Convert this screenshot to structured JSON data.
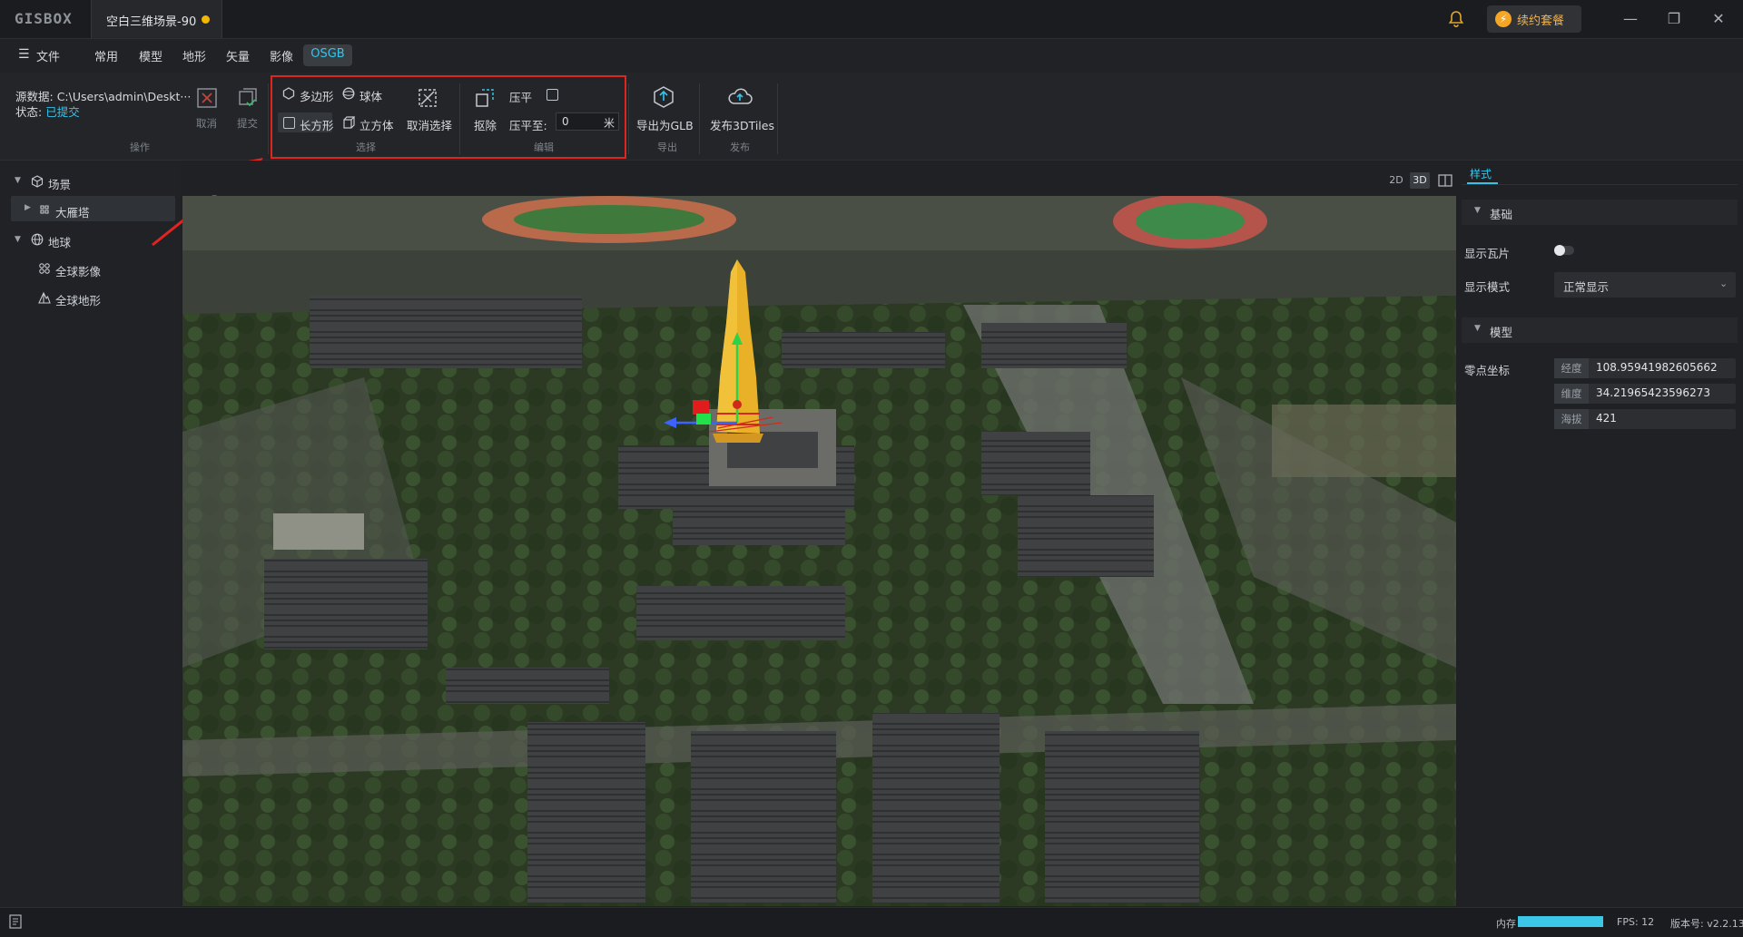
{
  "app": {
    "logo": "GISBOX",
    "doc_tab": "空白三维场景-90",
    "renew_label": "续约套餐",
    "icons": {
      "bell": "bell-icon",
      "renew": "bolt-icon",
      "minimize": "minimize-icon",
      "restore": "restore-icon",
      "close": "close-icon"
    }
  },
  "menu": {
    "file": "文件",
    "items": [
      "常用",
      "模型",
      "地形",
      "矢量",
      "影像",
      "OSGB"
    ],
    "active": "OSGB"
  },
  "ribbon": {
    "source_label": "源数据:",
    "source_value": "C:\\Users\\admin\\Deskt···",
    "status_label": "状态:",
    "status_value": "已提交",
    "cancel": "取消",
    "submit": "提交",
    "group_ops": "操作",
    "polygon": "多边形",
    "sphere": "球体",
    "rectangle": "长方形",
    "cube": "立方体",
    "deselect": "取消选择",
    "group_select": "选择",
    "erase": "抠除",
    "flatten": "压平",
    "flatten_to": "压平至:",
    "flatten_value": "0",
    "flatten_unit": "米",
    "group_edit": "编辑",
    "export_glb": "导出为GLB",
    "group_export": "导出",
    "publish_3dtiles": "发布3DTiles",
    "group_publish": "发布"
  },
  "tree": {
    "scene": "场景",
    "scene_item": "大雁塔",
    "earth": "地球",
    "earth_imagery": "全球影像",
    "earth_terrain": "全球地形"
  },
  "view_modes": [
    "2D",
    "3D",
    "split"
  ],
  "view_mode_active": "3D",
  "right_panel": {
    "tab": "样式",
    "section_basic": "基础",
    "show_tiles": "显示瓦片",
    "show_tiles_on": false,
    "display_mode_label": "显示模式",
    "display_mode_value": "正常显示",
    "section_model": "模型",
    "origin_label": "零点坐标",
    "lon_tag": "经度",
    "lon": "108.95941982605662",
    "lat_tag": "维度",
    "lat": "34.21965423596273",
    "alt_tag": "海拔",
    "alt": "421"
  },
  "status": {
    "memory_label": "内存",
    "memory_fraction": 1.0,
    "fps": "FPS: 12",
    "version": "版本号: v2.2.13"
  },
  "colors": {
    "accent": "#36c4ea",
    "highlight_box": "#e0251f",
    "renew": "#f2b24a",
    "dirty_dot": "#f2b705",
    "model_fill": "#e8b128"
  }
}
